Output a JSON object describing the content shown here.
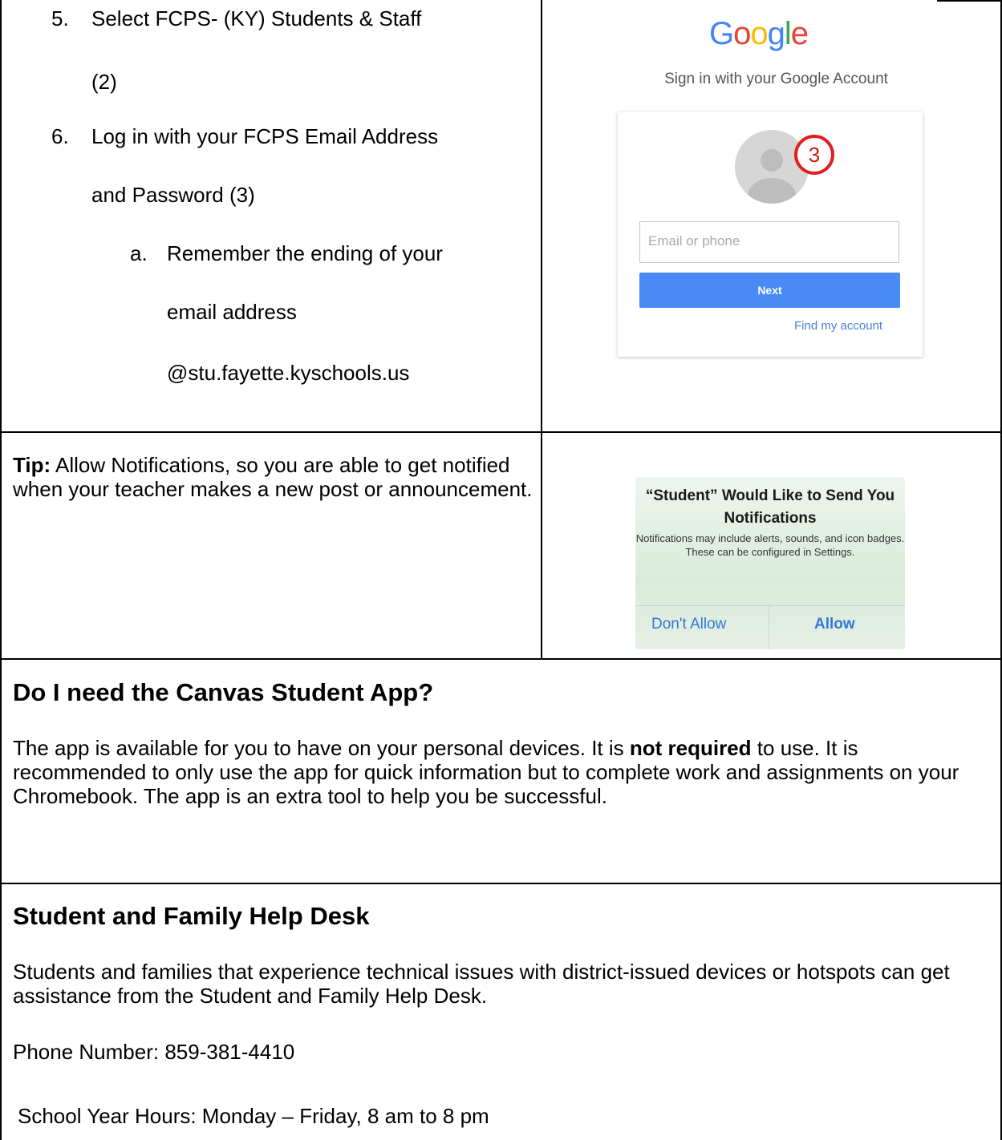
{
  "steps": {
    "step5": {
      "num": "5.",
      "line1": "Select FCPS- (KY) Students & Staff",
      "line2": "(2)"
    },
    "step6": {
      "num": "6.",
      "line1": "Log in with your FCPS Email Address",
      "line2": "and Password (3)"
    },
    "step6a": {
      "letter": "a.",
      "line1": "Remember the ending of your",
      "line2": "email address",
      "line3": "@stu.fayette.kyschools.us"
    }
  },
  "google_signin": {
    "logo_letters": [
      {
        "ch": "G",
        "color": "#4285F4"
      },
      {
        "ch": "o",
        "color": "#EA4335"
      },
      {
        "ch": "o",
        "color": "#FBBC05"
      },
      {
        "ch": "g",
        "color": "#4285F4"
      },
      {
        "ch": "l",
        "color": "#34A853"
      },
      {
        "ch": "e",
        "color": "#EA4335"
      }
    ],
    "subtitle": "Sign in with your Google Account",
    "email_placeholder": "Email or phone",
    "next_label": "Next",
    "find_account": "Find my account",
    "callout_number": "3"
  },
  "tip": {
    "label": "Tip:",
    "text": " Allow Notifications, so you are able to get notified when your teacher makes a new post or announcement."
  },
  "notification": {
    "title": "“Student” Would Like to Send You Notifications",
    "message": "Notifications may include alerts, sounds, and icon badges. These can be configured in Settings.",
    "dont_allow": "Don't Allow",
    "allow": "Allow"
  },
  "canvas_app": {
    "heading": "Do I need the Canvas Student App?",
    "text_before": "The app is available for you to have on your personal devices. It is ",
    "text_bold": "not required",
    "text_after": " to use. It is recommended to only use the app for quick information but to complete work and assignments on your Chromebook. The app is an extra tool to help you be successful."
  },
  "help_desk": {
    "heading": "Student and Family Help Desk",
    "intro": "Students and families that experience technical issues with district-issued devices or hotspots can get assistance from the Student and Family Help Desk.",
    "phone": "Phone Number: 859-381-4410",
    "hours": "School Year Hours: Monday – Friday, 8 am to 8 pm"
  }
}
